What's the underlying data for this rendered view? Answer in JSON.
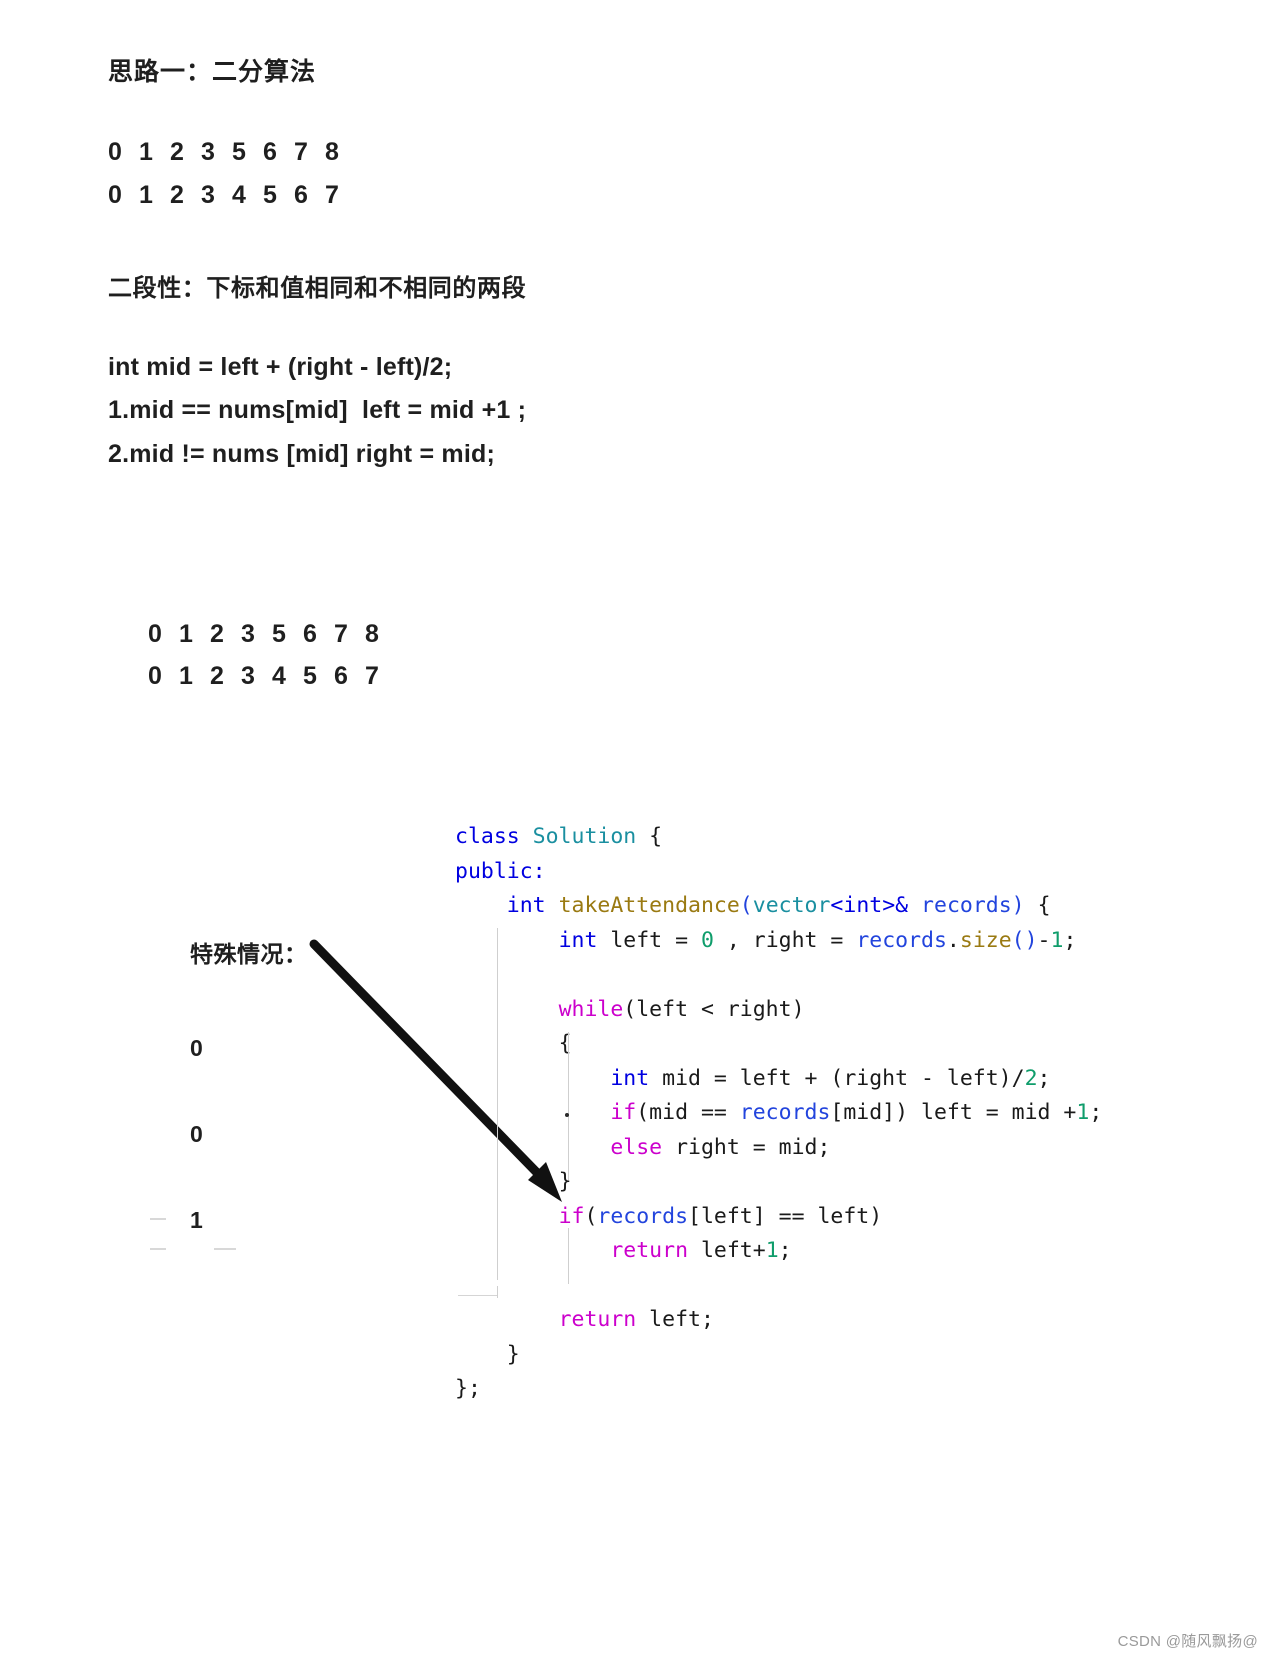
{
  "page": {
    "title": "思路一：二分算法",
    "background": "#ffffff",
    "text_color": "#1f1f1f"
  },
  "sections": {
    "approach_title": "思路一：二分算法",
    "monotonicity_heading": "二段性：下标和值相同和不相同的两段",
    "formulas": [
      "int mid = left + (right - left)/2;",
      "1.mid == nums[mid]  left = mid +1 ;",
      "2.mid != nums [mid] right = mid;"
    ]
  },
  "array_example_top": {
    "index_row": [
      "0",
      "1",
      "2",
      "3",
      "5",
      "6",
      "7",
      "8"
    ],
    "value_row": [
      "0",
      "1",
      "2",
      "3",
      "4",
      "5",
      "6",
      "7"
    ]
  },
  "array_example_second": {
    "index_row": [
      "0",
      "1",
      "2",
      "3",
      "5",
      "6",
      "7",
      "8"
    ],
    "value_row": [
      "0",
      "1",
      "2",
      "3",
      "4",
      "5",
      "6",
      "7"
    ]
  },
  "special_case": {
    "label": "特殊情况：",
    "values": [
      "0",
      "0",
      "1"
    ]
  },
  "code": {
    "language": "cpp",
    "lines": [
      {
        "id": "l1",
        "indent": 0,
        "tokens": [
          {
            "t": "class ",
            "c": "t-kw"
          },
          {
            "t": "Solution",
            "c": "t-type"
          },
          {
            "t": " {",
            "c": "t-punc"
          }
        ]
      },
      {
        "id": "l2",
        "indent": 0,
        "tokens": [
          {
            "t": "public:",
            "c": "t-kw"
          }
        ]
      },
      {
        "id": "l3",
        "indent": 1,
        "tokens": [
          {
            "t": "int",
            "c": "t-kw"
          },
          {
            "t": " ",
            "c": "t-punc"
          },
          {
            "t": "takeAttendance",
            "c": "t-fn"
          },
          {
            "t": "(",
            "c": "t-ident"
          },
          {
            "t": "vector",
            "c": "t-type"
          },
          {
            "t": "<",
            "c": "t-angle"
          },
          {
            "t": "int",
            "c": "t-kw"
          },
          {
            "t": ">&",
            "c": "t-angle"
          },
          {
            "t": " records",
            "c": "t-ident"
          },
          {
            "t": ")",
            "c": "t-ident"
          },
          {
            "t": " {",
            "c": "t-punc"
          }
        ]
      },
      {
        "id": "l4",
        "indent": 2,
        "tokens": [
          {
            "t": "int",
            "c": "t-kw"
          },
          {
            "t": " left = ",
            "c": "t-var"
          },
          {
            "t": "0",
            "c": "t-num"
          },
          {
            "t": " , right = ",
            "c": "t-var"
          },
          {
            "t": "records",
            "c": "t-ident"
          },
          {
            "t": ".",
            "c": "t-punc"
          },
          {
            "t": "size",
            "c": "t-fn"
          },
          {
            "t": "()",
            "c": "t-ident"
          },
          {
            "t": "-",
            "c": "t-var"
          },
          {
            "t": "1",
            "c": "t-num"
          },
          {
            "t": ";",
            "c": "t-var"
          }
        ]
      },
      {
        "id": "l5",
        "indent": 0,
        "tokens": [
          {
            "t": "",
            "c": "t-var"
          }
        ]
      },
      {
        "id": "l6",
        "indent": 2,
        "tokens": [
          {
            "t": "while",
            "c": "t-kw2"
          },
          {
            "t": "(left < right)",
            "c": "t-var"
          }
        ]
      },
      {
        "id": "l7",
        "indent": 2,
        "tokens": [
          {
            "t": "{",
            "c": "t-var"
          }
        ]
      },
      {
        "id": "l8",
        "indent": 3,
        "tokens": [
          {
            "t": "int",
            "c": "t-kw"
          },
          {
            "t": " mid = left + (right - left)/",
            "c": "t-var"
          },
          {
            "t": "2",
            "c": "t-num"
          },
          {
            "t": ";",
            "c": "t-var"
          }
        ]
      },
      {
        "id": "l9",
        "indent": 3,
        "tokens": [
          {
            "t": "if",
            "c": "t-kw2"
          },
          {
            "t": "(mid == ",
            "c": "t-var"
          },
          {
            "t": "records",
            "c": "t-ident"
          },
          {
            "t": "[mid]) left = mid +",
            "c": "t-var"
          },
          {
            "t": "1",
            "c": "t-num"
          },
          {
            "t": ";",
            "c": "t-var"
          }
        ]
      },
      {
        "id": "l10",
        "indent": 3,
        "tokens": [
          {
            "t": "else",
            "c": "t-kw2"
          },
          {
            "t": " right = mid;",
            "c": "t-var"
          }
        ]
      },
      {
        "id": "l11",
        "indent": 2,
        "tokens": [
          {
            "t": "}",
            "c": "t-var"
          }
        ]
      },
      {
        "id": "l12",
        "indent": 2,
        "tokens": [
          {
            "t": "if",
            "c": "t-kw2"
          },
          {
            "t": "(",
            "c": "t-var"
          },
          {
            "t": "records",
            "c": "t-ident"
          },
          {
            "t": "[left] == left)",
            "c": "t-var"
          }
        ]
      },
      {
        "id": "l13",
        "indent": 3,
        "tokens": [
          {
            "t": "return",
            "c": "t-kw2"
          },
          {
            "t": " left+",
            "c": "t-var"
          },
          {
            "t": "1",
            "c": "t-num"
          },
          {
            "t": ";",
            "c": "t-var"
          }
        ]
      },
      {
        "id": "l14",
        "indent": 0,
        "tokens": [
          {
            "t": "",
            "c": "t-var"
          }
        ]
      },
      {
        "id": "l15",
        "indent": 2,
        "tokens": [
          {
            "t": "return",
            "c": "t-kw2"
          },
          {
            "t": " left;",
            "c": "t-var"
          }
        ]
      },
      {
        "id": "l16",
        "indent": 1,
        "tokens": [
          {
            "t": "}",
            "c": "t-var"
          }
        ]
      },
      {
        "id": "l17",
        "indent": 0,
        "tokens": [
          {
            "t": "};",
            "c": "t-var"
          }
        ]
      }
    ],
    "colors": {
      "keyword": "#0000e0",
      "control_keyword": "#cc00cc",
      "type": "#1a8fa0",
      "function": "#9a7a12",
      "identifier": "#2244dd",
      "number": "#0f9d6b",
      "plain": "#1a1a1a"
    }
  },
  "annotations": {
    "arrow": {
      "from_label": "特殊情况：",
      "to_line_id": "l12",
      "color": "#111111"
    }
  },
  "watermark": "CSDN @随风飘扬@"
}
